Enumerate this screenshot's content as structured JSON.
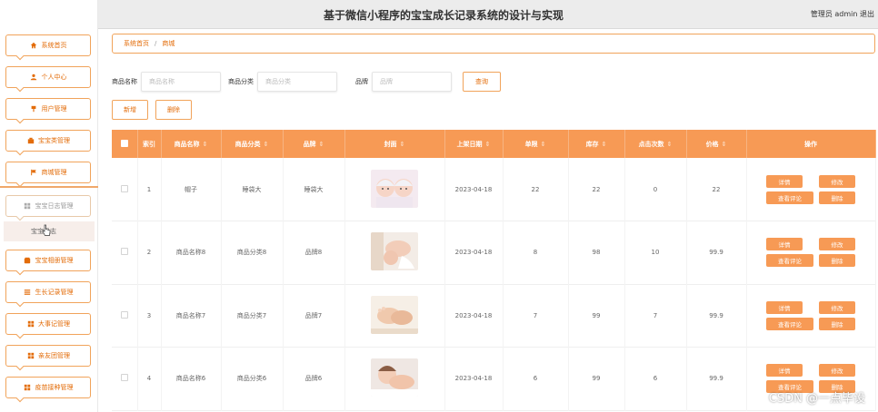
{
  "header": {
    "title": "基于微信小程序的宝宝成长记录系统的设计与实现",
    "user": "管理员 admin  退出"
  },
  "sidebar": {
    "items": [
      {
        "label": "系统首页",
        "icon": "home-icon"
      },
      {
        "label": "个人中心",
        "icon": "user-icon"
      },
      {
        "label": "用户管理",
        "icon": "pin-icon"
      },
      {
        "label": "宝宝类管理",
        "icon": "box-icon"
      },
      {
        "label": "商城管理",
        "icon": "flag-icon"
      },
      {
        "label": "宝宝日志管理",
        "icon": "grid-icon"
      },
      {
        "label": "宝宝相册管理",
        "icon": "box-icon"
      },
      {
        "label": "生长记录管理",
        "icon": "list-icon"
      },
      {
        "label": "大事记管理",
        "icon": "grid-icon"
      },
      {
        "label": "亲友团管理",
        "icon": "grid-icon"
      },
      {
        "label": "疫苗接种管理",
        "icon": "grid-icon"
      }
    ],
    "submenu_label": "宝宝日志"
  },
  "breadcrumb": {
    "home": "系统首页",
    "separator": "/",
    "current": "商城"
  },
  "search": {
    "fields": [
      {
        "label": "商品名称",
        "placeholder": "商品名称"
      },
      {
        "label": "商品分类",
        "placeholder": "商品分类"
      },
      {
        "label": "品牌",
        "placeholder": "品牌"
      }
    ],
    "button": "查询"
  },
  "actions": {
    "add": "新增",
    "delete": "删除"
  },
  "table": {
    "columns": [
      "索引",
      "商品名称",
      "商品分类",
      "品牌",
      "封面",
      "上架日期",
      "单限",
      "库存",
      "点击次数",
      "价格",
      "操作"
    ],
    "rows": [
      {
        "index": "1",
        "name": "帽子",
        "category": "睡袋大",
        "brand": "睡袋大",
        "date": "2023-04-18",
        "limit": "22",
        "stock": "22",
        "clicks": "0",
        "price": "22",
        "image": "twin-babies-photo"
      },
      {
        "index": "2",
        "name": "商品名称8",
        "category": "商品分类8",
        "brand": "品牌8",
        "date": "2023-04-18",
        "limit": "8",
        "stock": "98",
        "clicks": "10",
        "price": "99.9",
        "image": "mother-baby-photo"
      },
      {
        "index": "3",
        "name": "商品名称7",
        "category": "商品分类7",
        "brand": "品牌7",
        "date": "2023-04-18",
        "limit": "7",
        "stock": "99",
        "clicks": "7",
        "price": "99.9",
        "image": "baby-feet-photo"
      },
      {
        "index": "4",
        "name": "商品名称6",
        "category": "商品分类6",
        "brand": "品牌6",
        "date": "2023-04-18",
        "limit": "6",
        "stock": "99",
        "clicks": "6",
        "price": "99.9",
        "image": "sleeping-baby-photo"
      }
    ],
    "ops": {
      "detail": "详情",
      "edit": "修改",
      "comments": "查看评论",
      "delete": "删除"
    }
  },
  "watermark": "CSDN @一点毕设",
  "colors": {
    "accent": "#f79a55",
    "accent_text": "#e36c09",
    "border": "#f1a35a"
  }
}
